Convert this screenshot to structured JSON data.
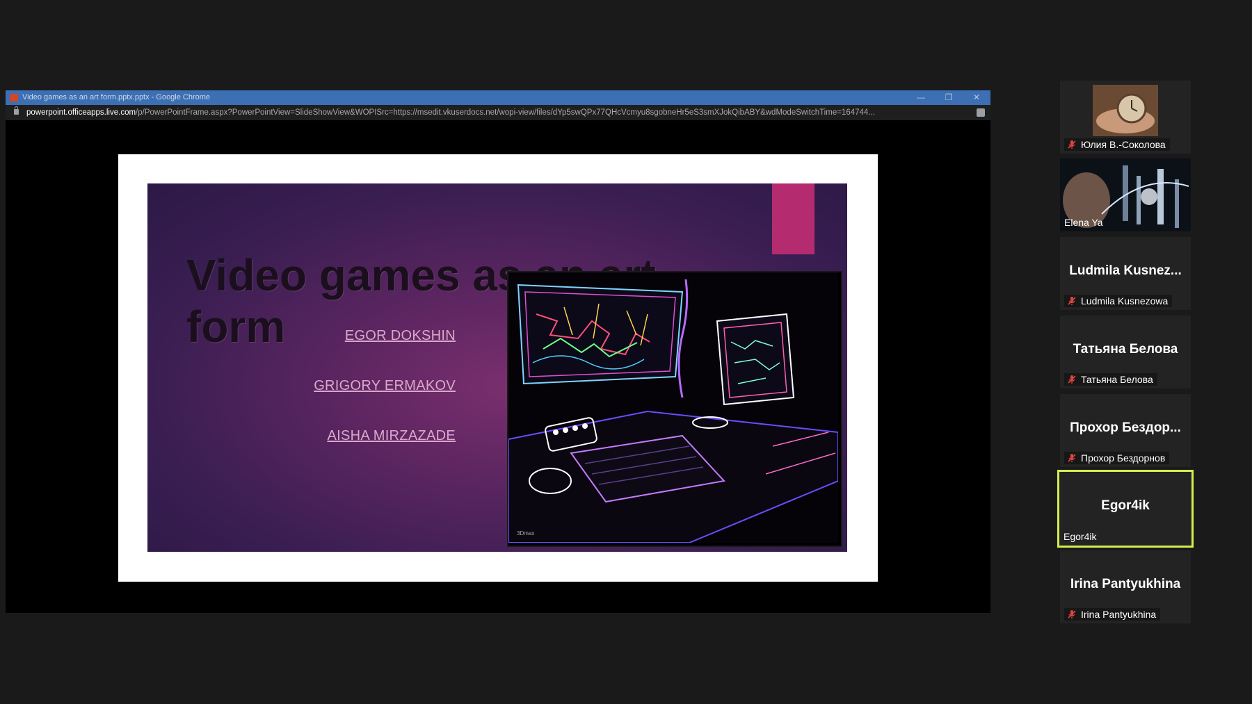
{
  "window": {
    "title": "Video games as an art form.pptx.pptx - Google Chrome",
    "controls": {
      "minimize": "—",
      "restore": "❐",
      "close": "✕"
    }
  },
  "address": {
    "host": "powerpoint.officeapps.live.com",
    "path": "/p/PowerPointFrame.aspx?PowerPointView=SlideShowView&WOPISrc=https://msedit.vkuserdocs.net/wopi-view/files/dYp5swQPx77QHcVcmyu8sgobneHr5eS3smXJokQibABY&wdModeSwitchTime=164744..."
  },
  "slide": {
    "title": "Video games as an art form",
    "authors": [
      "EGOR DOKSHIN",
      "GRIGORY ERMAKOV",
      "AISHA MIRZAZADE"
    ],
    "accent_color": "#b52b6f"
  },
  "participants": [
    {
      "big_name": "",
      "label": "Юлия В.-Соколова",
      "muted": true,
      "video": "clock"
    },
    {
      "big_name": "",
      "label": "Elena Ya",
      "muted": false,
      "video": "city"
    },
    {
      "big_name": "Ludmila Kusnez...",
      "label": "Ludmila Kusnezowa",
      "muted": true
    },
    {
      "big_name": "Татьяна Белова",
      "label": "Татьяна Белова",
      "muted": true
    },
    {
      "big_name": "Прохор Бездор...",
      "label": "Прохор Бездорнов",
      "muted": true
    },
    {
      "big_name": "Egor4ik",
      "label": "Egor4ik",
      "muted": false,
      "active": true
    },
    {
      "big_name": "Irina Pantyukhina",
      "label": "Irina Pantyukhina",
      "muted": true
    }
  ],
  "colors": {
    "active_speaker_border": "#d5ee4f",
    "mute_icon": "#e0443e"
  }
}
